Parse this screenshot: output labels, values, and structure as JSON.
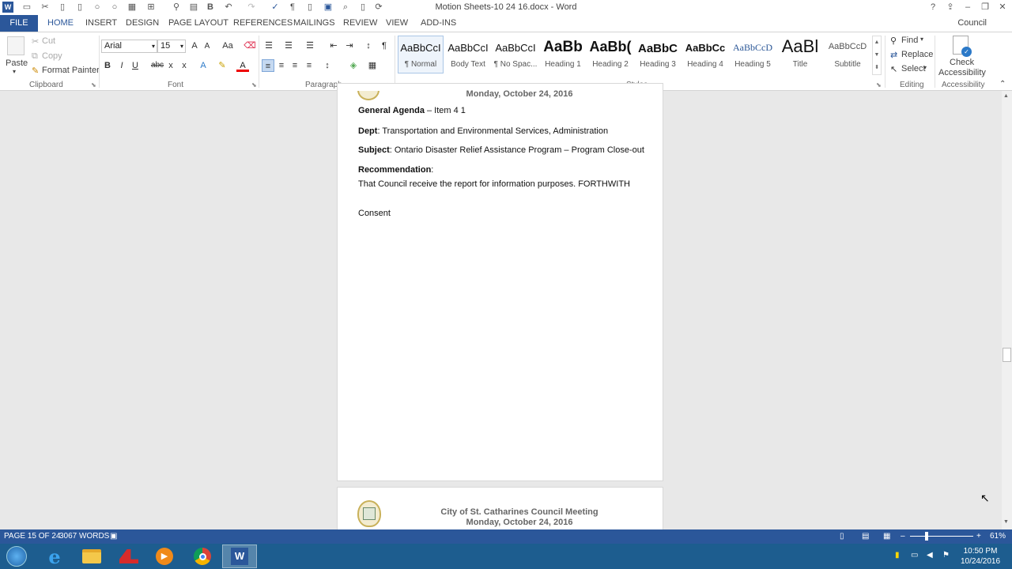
{
  "window": {
    "title": "Motion Sheets-10 24 16.docx - Word",
    "help": "?",
    "minimize": "–",
    "restore": "❐",
    "close": "✕"
  },
  "account": {
    "user": "Council"
  },
  "tabs": [
    "FILE",
    "HOME",
    "INSERT",
    "DESIGN",
    "PAGE LAYOUT",
    "REFERENCES",
    "MAILINGS",
    "REVIEW",
    "VIEW",
    "ADD-INS"
  ],
  "clipboard": {
    "paste": "Paste",
    "cut": "Cut",
    "copy": "Copy",
    "format_painter": "Format Painter",
    "group": "Clipboard"
  },
  "font": {
    "name": "Arial",
    "size": "15",
    "group": "Font",
    "grow": "A",
    "shrink": "A",
    "case": "Aa",
    "bold": "B",
    "italic": "I",
    "underline": "U",
    "strike": "abc",
    "sub": "x",
    "sup": "x"
  },
  "paragraph": {
    "group": "Paragraph",
    "pilcrow": "¶"
  },
  "styles": {
    "group": "Styles",
    "items": [
      {
        "sample": "AaBbCcI",
        "name": "¶ Normal"
      },
      {
        "sample": "AaBbCcI",
        "name": "Body Text"
      },
      {
        "sample": "AaBbCcI",
        "name": "¶ No Spac..."
      },
      {
        "sample": "AaBb",
        "name": "Heading 1"
      },
      {
        "sample": "AaBb(",
        "name": "Heading 2"
      },
      {
        "sample": "AaBbC",
        "name": "Heading 3"
      },
      {
        "sample": "AaBbCc",
        "name": "Heading 4"
      },
      {
        "sample": "AaBbCcD",
        "name": "Heading 5"
      },
      {
        "sample": "AaBl",
        "name": "Title"
      },
      {
        "sample": "AaBbCcD",
        "name": "Subtitle"
      }
    ]
  },
  "editing": {
    "find": "Find",
    "replace": "Replace",
    "select": "Select",
    "group": "Editing"
  },
  "accessibility": {
    "check": "Check",
    "check2": "Accessibility",
    "group": "Accessibility"
  },
  "document": {
    "page1_date": "Monday, October 24, 2016",
    "agenda_label": "General Agenda",
    "agenda_value": " – Item 4 1",
    "dept_label": "Dept",
    "dept_value": ": Transportation and Environmental Services, Administration",
    "subject_label": "Subject",
    "subject_value": ": Ontario Disaster Relief Assistance Program – Program Close-out",
    "rec_label": "Recommendation",
    "rec_colon": ":",
    "rec_text": "That Council receive the report for information purposes. FORTHWITH",
    "consent": "Consent",
    "page2_header1": "City of St. Catharines Council Meeting",
    "page2_header2": "Monday, October 24, 2016"
  },
  "status": {
    "page": "PAGE 15 OF 24",
    "words": "3067 WORDS",
    "zoom": "61%"
  },
  "tray": {
    "time": "10:50 PM",
    "date": "10/24/2016"
  },
  "colors": {
    "accent": "#2b579a",
    "taskbar": "#1d5d8f"
  }
}
